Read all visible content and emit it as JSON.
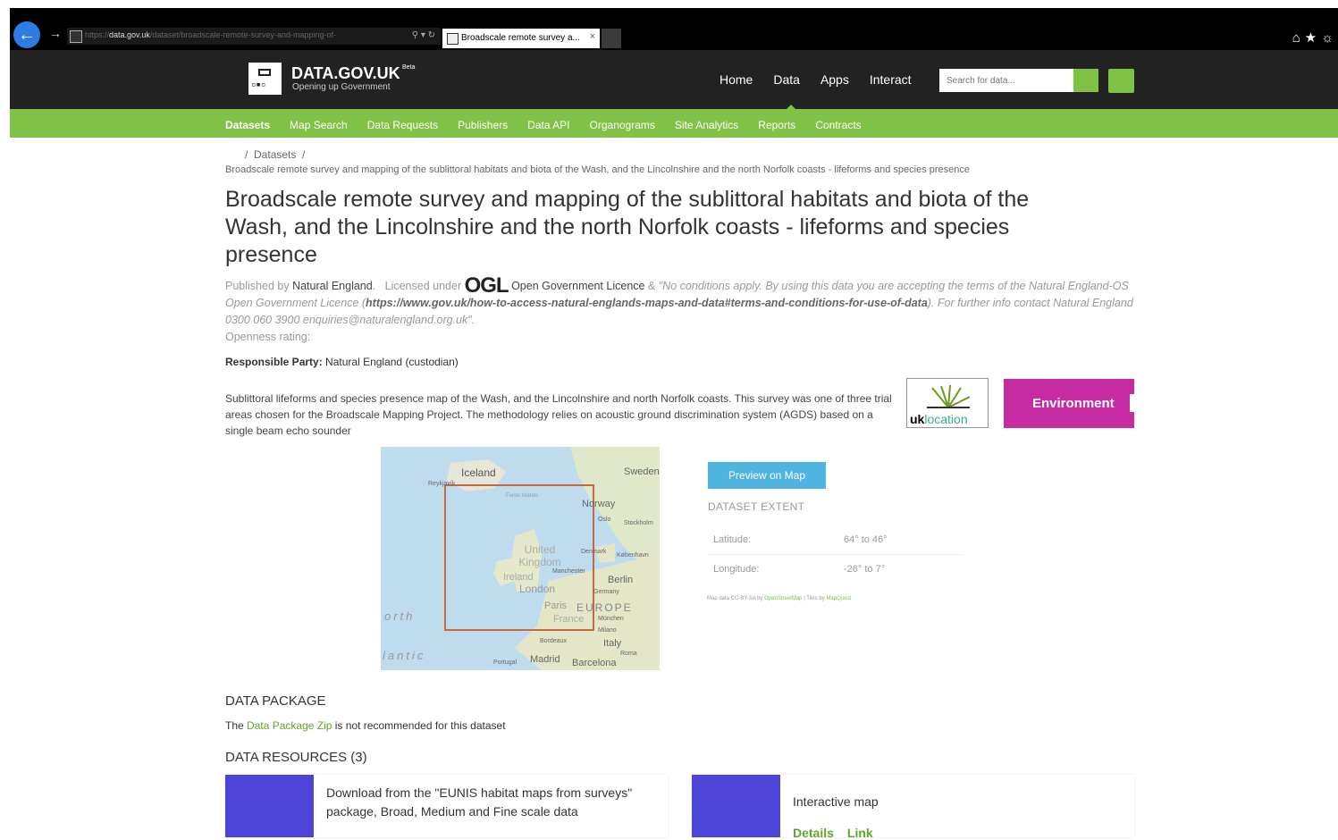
{
  "browser": {
    "url_prefix": "https://",
    "url_domain": "data.gov.uk",
    "url_path": "/dataset/broadscale-remote-survey-and-mapping-of-",
    "tab_label": "Broadscale remote survey a...",
    "tab_close": "×",
    "url_controls": "⚲ ▾ ↻"
  },
  "site": {
    "title": "DATA.GOV.UK",
    "beta": "Beta",
    "subtitle": "Opening up Government",
    "logo_glyph": "▫▪▫",
    "nav": [
      "Home",
      "Data",
      "Apps",
      "Interact"
    ],
    "search_placeholder": "Search for data..."
  },
  "subnav": [
    "Datasets",
    "Map Search",
    "Data Requests",
    "Publishers",
    "Data API",
    "Organograms",
    "Site Analytics",
    "Reports",
    "Contracts"
  ],
  "breadcrumb": {
    "sep": "/",
    "datasets": "Datasets",
    "current": "Broadscale remote survey and mapping of the sublittoral habitats and biota of the Wash, and the Lincolnshire and the north Norfolk coasts - lifeforms and species presence"
  },
  "dataset": {
    "title": "Broadscale remote survey and mapping of the sublittoral habitats and biota of the Wash, and the Lincolnshire and the north Norfolk coasts - lifeforms and species presence",
    "published_by_label": "Published by",
    "publisher": "Natural England",
    "licensed_label": "Licensed under",
    "ogl": "OGL",
    "licence": "Open Government Licence",
    "amp": "&",
    "licence_note_1": "\"No conditions apply. By using this data you are accepting the terms of the Natural England-OS Open Government Licence (",
    "licence_url": "https://www.gov.uk/how-to-access-natural-englands-maps-and-data#terms-and-conditions-for-use-of-data",
    "licence_note_2": "). For further info contact Natural England 0300 060 3900 enquiries@naturalengland.org.uk\".",
    "openness": "Openness rating:",
    "responsible_label": "Responsible Party:",
    "responsible_value": "Natural England (custodian)",
    "description": "Sublittoral lifeforms and species presence map of the Wash, and the Lincolnshire and north Norfolk coasts. This survey was one of three trial areas chosen for the Broadscale Mapping Project. The methodology relies on acoustic ground discrimination system (AGDS) based on a single beam echo sounder"
  },
  "badges": {
    "uk_location_uk": "uk",
    "uk_location_loc": "location",
    "theme": "Environment"
  },
  "map": {
    "labels": [
      "Iceland",
      "Reykjavík",
      "Faroe Islands",
      "Norway",
      "Sweden",
      "Oslo",
      "Stockholm",
      "United Kingdom",
      "Ireland",
      "Manchester",
      "London",
      "Denmark",
      "København",
      "Berlin",
      "Germany",
      "Paris",
      "EUROPE",
      "France",
      "München",
      "Bordeaux",
      "Milano",
      "Italy",
      "Madrid",
      "Portugal",
      "Barcelona",
      "Roma",
      "orth",
      "lantic"
    ]
  },
  "extent": {
    "preview_button": "Preview on Map",
    "title": "DATASET EXTENT",
    "rows": [
      {
        "label": "Latitude:",
        "value": "64° to 46°"
      },
      {
        "label": "Longitude:",
        "value": "-26° to 7°"
      }
    ],
    "attribution_prefix": "Map data CC-BY-SA by",
    "attribution_osm": "OpenStreetMap",
    "attribution_mid": "| Tiles by",
    "attribution_mq": "MapQuest"
  },
  "data_package": {
    "heading": "DATA PACKAGE",
    "text_pre": "The",
    "link": "Data Package Zip",
    "text_post": "is not recommended for this dataset"
  },
  "resources": {
    "heading": "DATA RESOURCES (3)",
    "items": [
      {
        "title": "Download from the \"EUNIS habitat maps from surveys\" package, Broad, Medium and Fine scale data",
        "details": "",
        "link": ""
      },
      {
        "title": "Interactive map",
        "details": "Details",
        "link": "Link"
      }
    ]
  },
  "colors": {
    "green": "#80c245",
    "header": "#222222",
    "environment": "#c62ba2",
    "resource_blue": "#4b44d6",
    "preview_blue": "#4fb4e0"
  }
}
